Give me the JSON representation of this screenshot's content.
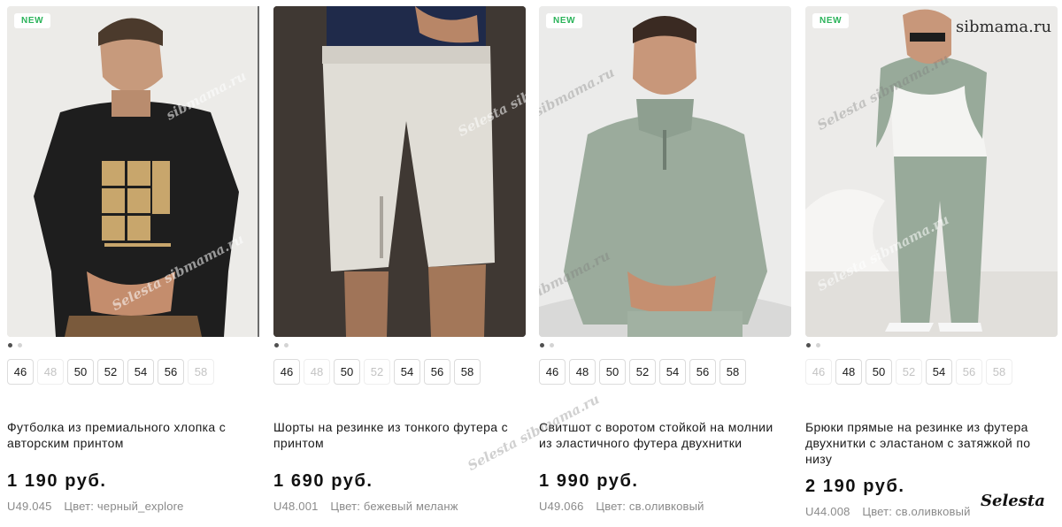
{
  "products": [
    {
      "badge": "NEW",
      "sizes": [
        {
          "label": "46",
          "available": true
        },
        {
          "label": "48",
          "available": false
        },
        {
          "label": "50",
          "available": true
        },
        {
          "label": "52",
          "available": true
        },
        {
          "label": "54",
          "available": true
        },
        {
          "label": "56",
          "available": true
        },
        {
          "label": "58",
          "available": false
        }
      ],
      "title": "Футболка из премиального хлопка с авторским принтом",
      "price": "1 190 руб.",
      "sku": "U49.045",
      "color": "Цвет: черный_explore"
    },
    {
      "badge": "",
      "sizes": [
        {
          "label": "46",
          "available": true
        },
        {
          "label": "48",
          "available": false
        },
        {
          "label": "50",
          "available": true
        },
        {
          "label": "52",
          "available": false
        },
        {
          "label": "54",
          "available": true
        },
        {
          "label": "56",
          "available": true
        },
        {
          "label": "58",
          "available": true
        }
      ],
      "title": "Шорты на резинке из тонкого футера с принтом",
      "price": "1 690 руб.",
      "sku": "U48.001",
      "color": "Цвет: бежевый меланж"
    },
    {
      "badge": "NEW",
      "sizes": [
        {
          "label": "46",
          "available": true
        },
        {
          "label": "48",
          "available": true
        },
        {
          "label": "50",
          "available": true
        },
        {
          "label": "52",
          "available": true
        },
        {
          "label": "54",
          "available": true
        },
        {
          "label": "56",
          "available": true
        },
        {
          "label": "58",
          "available": true
        }
      ],
      "title": "Свитшот с воротом стойкой на молнии из эластичного футера двухнитки",
      "price": "1 990 руб.",
      "sku": "U49.066",
      "color": "Цвет: св.оливковый"
    },
    {
      "badge": "NEW",
      "sizes": [
        {
          "label": "46",
          "available": false
        },
        {
          "label": "48",
          "available": true
        },
        {
          "label": "50",
          "available": true
        },
        {
          "label": "52",
          "available": false
        },
        {
          "label": "54",
          "available": true
        },
        {
          "label": "56",
          "available": false
        },
        {
          "label": "58",
          "available": false
        }
      ],
      "title": "Брюки прямые на резинке из футера двухнитки с эластаном с затяжкой по низу",
      "price": "2 190 руб.",
      "sku": "U44.008",
      "color": "Цвет: св.оливковый"
    }
  ],
  "watermark": {
    "site": "sibmama.ru",
    "overlay": "Selesta sibmama.ru",
    "brand": "Selesta"
  },
  "colors": {
    "badge_text": "#2bb35a",
    "size_unavailable": "#c3c3c3",
    "meta_text": "#8a8a8a"
  }
}
